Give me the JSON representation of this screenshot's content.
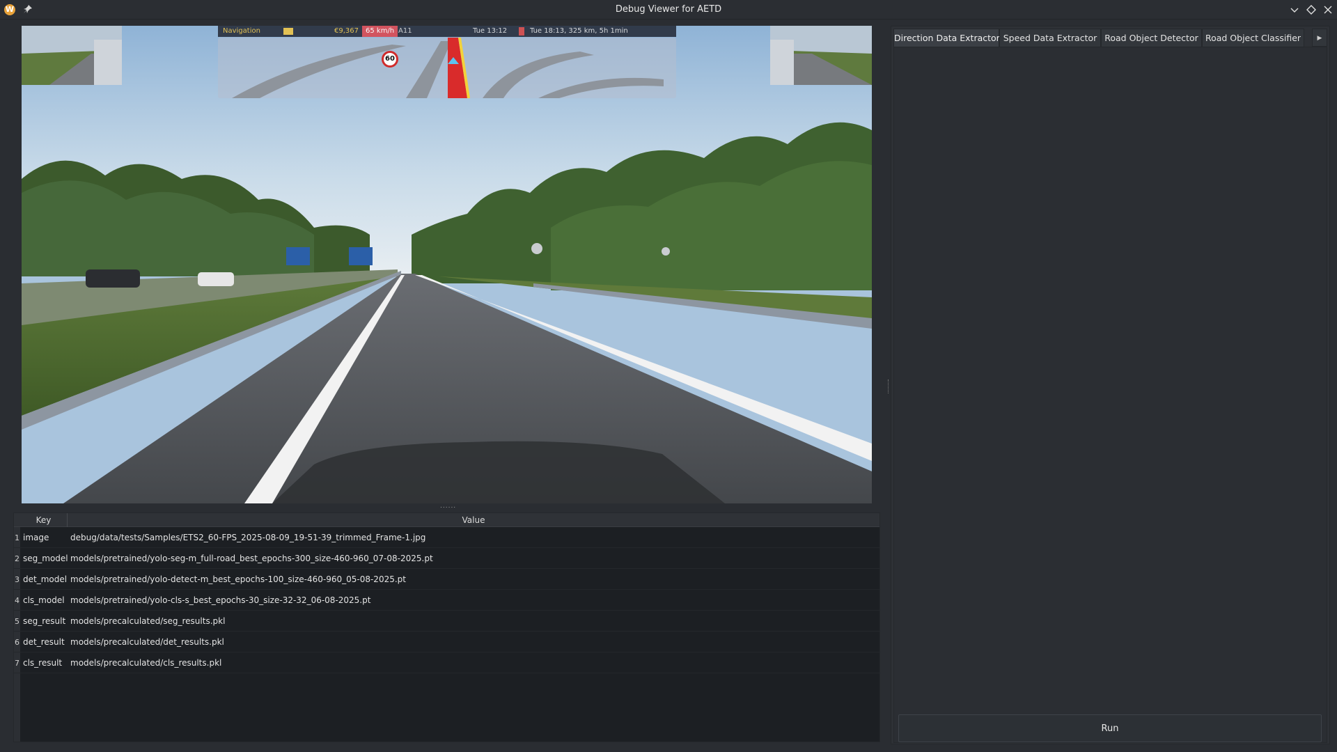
{
  "window": {
    "title": "Debug Viewer for AETD",
    "app_icon_glyph": "W",
    "icons": [
      "app-icon",
      "pin-icon",
      "minimize-icon",
      "maximize-icon",
      "close-icon"
    ]
  },
  "frame_view": {
    "hud": {
      "navigation_label": "Navigation",
      "money": "€9,367",
      "speed": "65 km/h",
      "road": "A11",
      "time": "Tue 13:12",
      "eta": "Tue 18:13, 325 km, 5h 1min",
      "speed_limit": "60"
    },
    "splitter_glyph": "......"
  },
  "table": {
    "headers": {
      "key": "Key",
      "value": "Value"
    },
    "rows": [
      {
        "n": "1",
        "key": "image",
        "value": "debug/data/tests/Samples/ETS2_60-FPS_2025-08-09_19-51-39_trimmed_Frame-1.jpg"
      },
      {
        "n": "2",
        "key": "seg_model",
        "value": "models/pretrained/yolo-seg-m_full-road_best_epochs-300_size-460-960_07-08-2025.pt"
      },
      {
        "n": "3",
        "key": "det_model",
        "value": "models/pretrained/yolo-detect-m_best_epochs-100_size-460-960_05-08-2025.pt"
      },
      {
        "n": "4",
        "key": "cls_model",
        "value": "models/pretrained/yolo-cls-s_best_epochs-30_size-32-32_06-08-2025.pt"
      },
      {
        "n": "5",
        "key": "seg_result",
        "value": "models/precalculated/seg_results.pkl"
      },
      {
        "n": "6",
        "key": "det_result",
        "value": "models/precalculated/det_results.pkl"
      },
      {
        "n": "7",
        "key": "cls_result",
        "value": "models/precalculated/cls_results.pkl"
      }
    ]
  },
  "right_panel": {
    "tabs": [
      {
        "label": "Direction Data Extractor",
        "active": true
      },
      {
        "label": "Speed Data Extractor",
        "active": false
      },
      {
        "label": "Road Object Detector",
        "active": false
      },
      {
        "label": "Road Object Classifier",
        "active": false
      }
    ],
    "tab_scroll_glyph": "▶",
    "run_label": "Run"
  },
  "colors": {
    "background": "#2a2d32",
    "table_bg": "#1c1f23",
    "hud_speed_bg": "#d84c55",
    "hud_text": "#e9c34a"
  }
}
